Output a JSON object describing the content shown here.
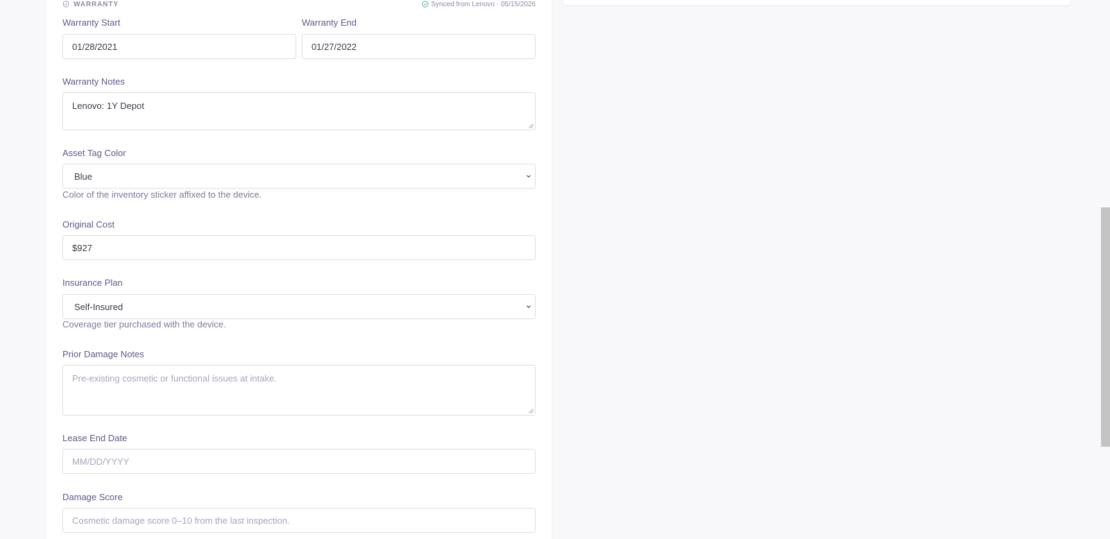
{
  "warranty": {
    "section_title": "WARRANTY",
    "sync_status": "Synced from Lenovo · 05/15/2026",
    "start_label": "Warranty Start",
    "start_value": "01/28/2021",
    "end_label": "Warranty End",
    "end_value": "01/27/2022",
    "notes_label": "Warranty Notes",
    "notes_value": "Lenovo: 1Y Depot"
  },
  "asset_tag": {
    "label": "Asset Tag Color",
    "selected": "Blue",
    "help": "Color of the inventory sticker affixed to the device."
  },
  "original_cost": {
    "label": "Original Cost",
    "value": "$927"
  },
  "insurance": {
    "label": "Insurance Plan",
    "selected": "Self-Insured",
    "help": "Coverage tier purchased with the device."
  },
  "prior_damage": {
    "label": "Prior Damage Notes",
    "placeholder": "Pre-existing cosmetic or functional issues at intake."
  },
  "lease_end": {
    "label": "Lease End Date",
    "placeholder": "MM/DD/YYYY"
  },
  "damage_score": {
    "label": "Damage Score",
    "placeholder": "Cosmetic damage score 0–10 from the last inspection."
  },
  "icons": {
    "section": "shield-check-icon",
    "sync": "check-circle-icon",
    "select": "chevron-down-icon"
  },
  "colors": {
    "label": "#5a5a8c",
    "border": "#dcdce8",
    "muted": "#8a8aa8"
  }
}
